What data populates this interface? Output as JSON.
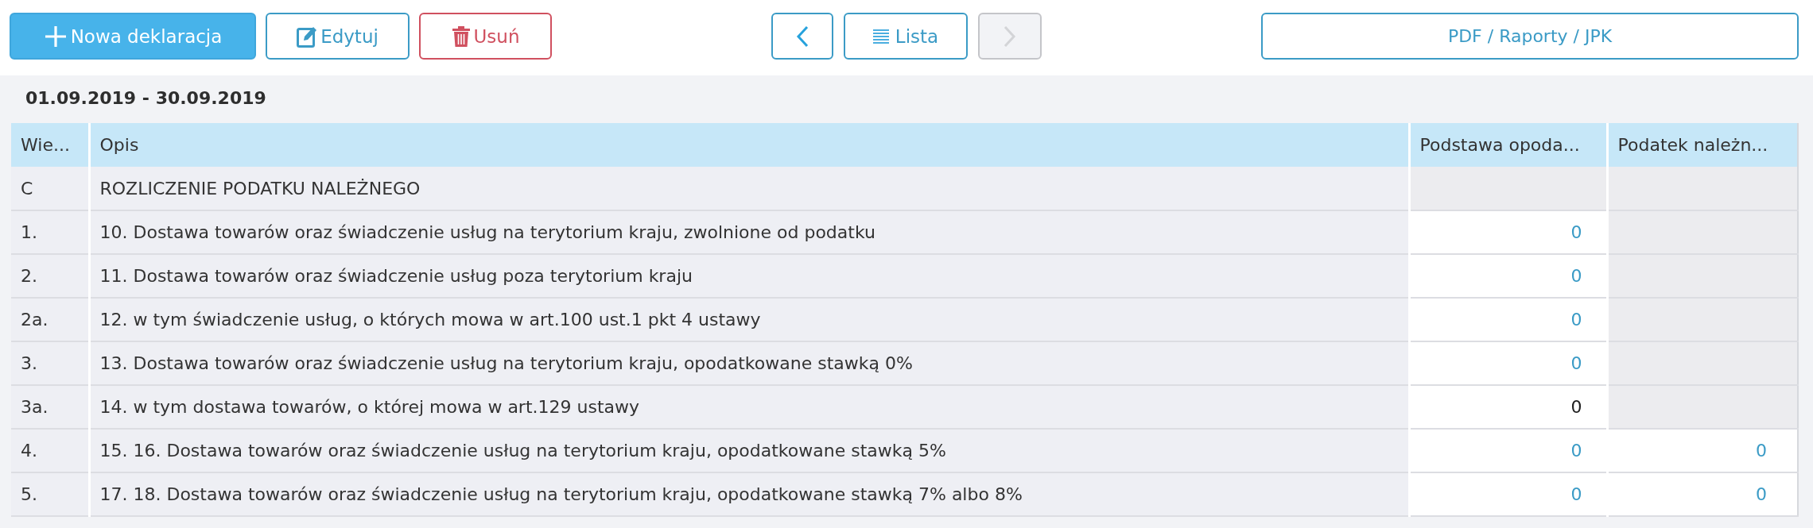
{
  "toolbar": {
    "actions": [
      {
        "label": "Nowa deklaracja",
        "kind": "add"
      },
      {
        "label": "Edytuj",
        "kind": "edit"
      },
      {
        "label": "Usuń",
        "kind": "delete"
      }
    ],
    "navigation": {
      "previous": {
        "disabled": false
      },
      "list": {
        "label": "Lista"
      },
      "next": {
        "disabled": true
      }
    },
    "reports": {
      "label": "PDF / Raporty / JPK"
    }
  },
  "period": "01.09.2019 - 30.09.2019",
  "table": {
    "columns": [
      "Wie...",
      "Opis",
      "Podstawa opoda...",
      "Podatek należn..."
    ],
    "rows": [
      {
        "code": "C",
        "description": "ROZLICZENIE PODATKU NALEŻNEGO",
        "base": {
          "disabled": true
        },
        "tax": {
          "disabled": true
        }
      },
      {
        "code": "1.",
        "description": "10. Dostawa towarów oraz świadczenie usług na terytorium kraju, zwolnione od podatku",
        "base": {
          "disabled": false,
          "value": "0",
          "kind": "link"
        },
        "tax": {
          "disabled": true
        }
      },
      {
        "code": "2.",
        "description": "11. Dostawa towarów oraz świadczenie usług poza terytorium kraju",
        "base": {
          "disabled": false,
          "value": "0",
          "kind": "link"
        },
        "tax": {
          "disabled": true
        }
      },
      {
        "code": "2a.",
        "description": "12. w tym świadczenie usług, o których mowa w art.100 ust.1 pkt 4 ustawy",
        "base": {
          "disabled": false,
          "value": "0",
          "kind": "link"
        },
        "tax": {
          "disabled": true
        }
      },
      {
        "code": "3.",
        "description": "13. Dostawa towarów oraz świadczenie usług na terytorium kraju, opodatkowane stawką 0%",
        "base": {
          "disabled": false,
          "value": "0",
          "kind": "link"
        },
        "tax": {
          "disabled": true
        }
      },
      {
        "code": "3a.",
        "description": "14. w tym dostawa towarów, o której mowa w art.129 ustawy",
        "base": {
          "disabled": false,
          "value": "0",
          "kind": "plain"
        },
        "tax": {
          "disabled": true
        }
      },
      {
        "code": "4.",
        "description": "15. 16. Dostawa towarów oraz świadczenie usług na terytorium kraju, opodatkowane stawką 5%",
        "base": {
          "disabled": false,
          "value": "0",
          "kind": "link"
        },
        "tax": {
          "disabled": false,
          "value": "0",
          "kind": "link"
        }
      },
      {
        "code": "5.",
        "description": "17. 18. Dostawa towarów oraz świadczenie usług na terytorium kraju, opodatkowane stawką 7% albo 8%",
        "base": {
          "disabled": false,
          "value": "0",
          "kind": "link"
        },
        "tax": {
          "disabled": false,
          "value": "0",
          "kind": "link"
        }
      }
    ]
  }
}
